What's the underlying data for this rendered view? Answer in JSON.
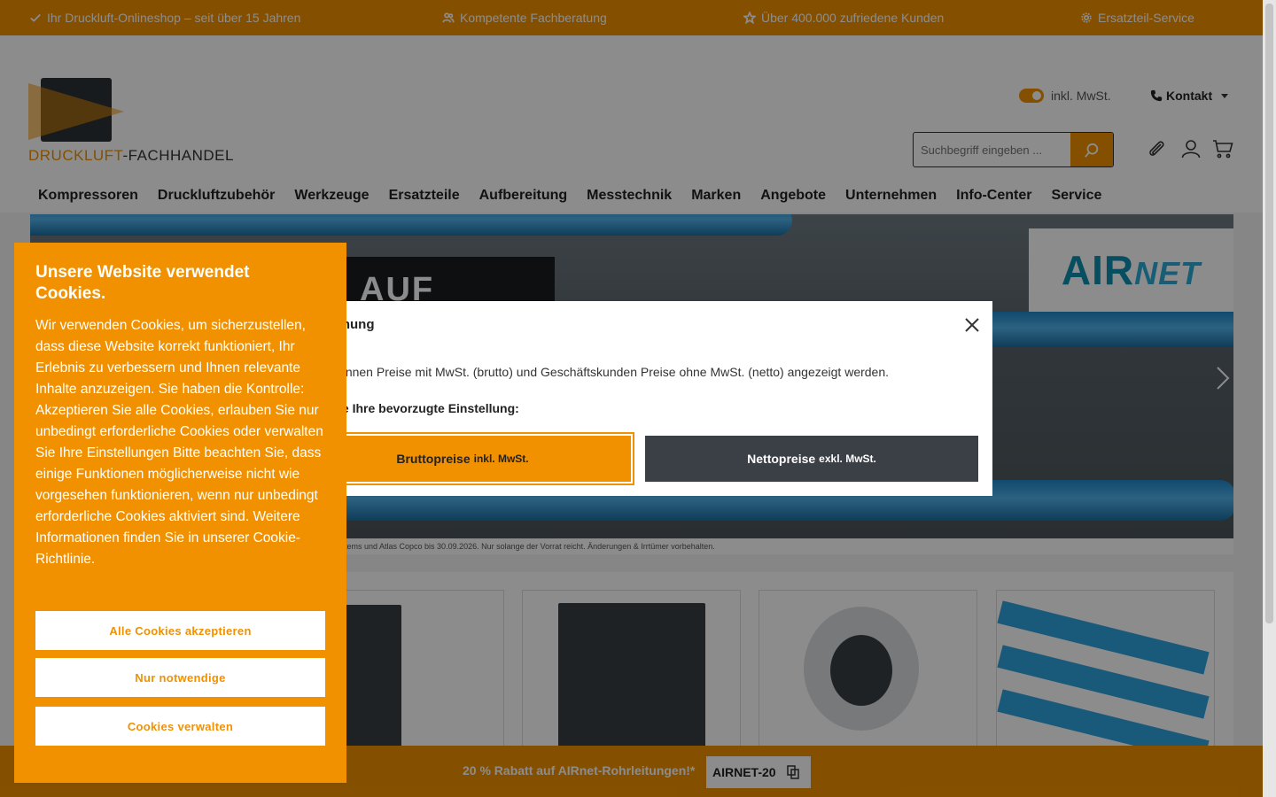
{
  "usp_bar": {
    "items": [
      {
        "label": "Ihr Druckluft-Onlineshop – seit über 15 Jahren",
        "icon": "check-icon"
      },
      {
        "label": "Kompetente Fachberatung",
        "icon": "users-icon"
      },
      {
        "label": "Über 400.000 zufriedene Kunden",
        "icon": "star-icon"
      },
      {
        "label": "Ersatzteil-Service",
        "icon": "gear-icon"
      }
    ]
  },
  "header": {
    "logo": {
      "part1": "DRUCKLUFT",
      "part2": "-FACHHANDEL"
    },
    "tax_toggle_label": "inkl. MwSt.",
    "contact_label": "Kontakt",
    "search_placeholder": "Suchbegriff eingeben ..."
  },
  "nav": {
    "items": [
      "Kompressoren",
      "Druckluftzubehör",
      "Werkzeuge",
      "Ersatzteile",
      "Aufbereitung",
      "Messtechnik",
      "Marken",
      "Angebote",
      "Unternehmen",
      "Info-Center",
      "Service"
    ]
  },
  "banner": {
    "headline": "AUF",
    "brand": "AIR",
    "brand_suffix": "NET",
    "disclaimer": "ystems und Atlas Copco bis 30.09.2026. Nur solange der Vorrat reicht. Änderungen & Irrtümer vorbehalten."
  },
  "tax_modal": {
    "title": "szeichnung",
    "text": "nden können Preise mit MwSt. (brutto) und Geschäftskunden Preise ohne MwSt. (netto) angezeigt werden.",
    "choose": "hlen Sie Ihre bevorzugte Einstellung:",
    "brutto_label": "Bruttopreise",
    "brutto_suffix": "inkl. MwSt.",
    "netto_label": "Nettopreise",
    "netto_suffix": "exkl. MwSt."
  },
  "cookie": {
    "title": "Unsere Website verwendet Cookies.",
    "body": "Wir verwenden Cookies, um sicherzustellen, dass diese Website korrekt funktioniert, Ihr Erlebnis zu verbessern und Ihnen relevante Inhalte anzuzeigen. Sie haben die Kontrolle: Akzeptieren Sie alle Cookies, erlauben Sie nur unbedingt erforderliche Cookies oder verwalten Sie Ihre Einstellungen Bitte beachten Sie, dass einige Funktionen möglicherweise nicht wie vorgesehen funktionieren, wenn nur unbedingt erforderliche Cookies aktiviert sind. Weitere Informationen finden Sie in unserer Cookie-Richtlinie.",
    "accept_all": "Alle Cookies akzeptieren",
    "necessary_only": "Nur notwendige",
    "manage": "Cookies verwalten"
  },
  "promo": {
    "text": "20 % Rabatt auf AIRnet-Rohrleitungen!*",
    "code": "AIRNET-20"
  },
  "colors": {
    "accent": "#f29100",
    "dark": "#3a4046"
  }
}
